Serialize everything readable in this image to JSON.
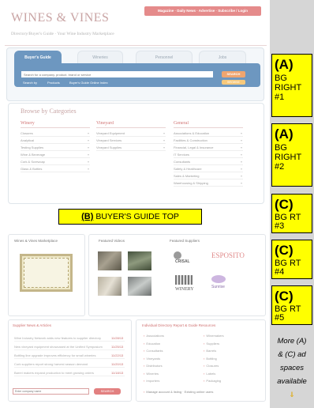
{
  "site": {
    "logo": "WINES & VINES",
    "tagline": "Directory/Buyer's Guide · Your Wine Industry Marketplace",
    "top_link": "Magazine · Daily News · Advertise · Subscribe / Login"
  },
  "search": {
    "tabs": [
      {
        "label": "Buyer's Guide",
        "active": true
      },
      {
        "label": "Wineries",
        "active": false
      },
      {
        "label": "Personnel",
        "active": false
      },
      {
        "label": "Jobs",
        "active": false
      }
    ],
    "placeholder": "Search for a company, product, brand or service",
    "button": "SEARCH",
    "browse": "BROWSE",
    "sublinks": [
      "Search by",
      "Products",
      "Buyer's Guide Online Index"
    ]
  },
  "categories": {
    "title": "Browse by Categories",
    "columns": [
      {
        "heading": "Winery",
        "items": [
          "Closures",
          "Analytical",
          "Testing Supplies",
          "Wine & Beverage",
          "Cork & Screwcap",
          "Glass & Bottles"
        ]
      },
      {
        "heading": "Vineyard",
        "items": [
          "Vineyard Equipment",
          "Vineyard Services",
          "Vineyard Supplies"
        ]
      },
      {
        "heading": "General",
        "items": [
          "Associations & Education",
          "Facilities & Construction",
          "Financial, Legal & Insurance",
          "IT Services",
          "Consultants",
          "Safety & Healthcare",
          "Sales & Marketing",
          "Warehousing & Shipping"
        ]
      }
    ]
  },
  "ad_labels": {
    "buyers_guide_top": {
      "letter": "(B)",
      "text": "BUYER'S GUIDE TOP"
    },
    "side_ads": [
      {
        "letter": "(A)",
        "lines": [
          "BG",
          "RIGHT",
          "#1"
        ]
      },
      {
        "letter": "(A)",
        "lines": [
          "BG",
          "RIGHT",
          "#2"
        ]
      },
      {
        "letter": "(C)",
        "lines": [
          "BG RT",
          "#3"
        ]
      },
      {
        "letter": "(C)",
        "lines": [
          "BG RT",
          "#4"
        ]
      },
      {
        "letter": "(C)",
        "lines": [
          "BG RT",
          "#5"
        ]
      }
    ],
    "more": [
      "More (A)",
      "& (C) ad",
      "spaces",
      "available"
    ],
    "more_arrow": "⇓"
  },
  "panels": {
    "marketplace_title": "Wines & Vines Marketplace",
    "videos_title": "Featured Videos",
    "suppliers_title": "Featured Suppliers",
    "suppliers": [
      "CRISAL",
      "ESPOSITO",
      "WINERY",
      "Sunrise"
    ],
    "news_title": "Supplier News & Articles",
    "news": [
      {
        "text": "Wine Industry Network adds new features to supplier directory",
        "date": "11/28/13"
      },
      {
        "text": "New vineyard equipment showcased at the Unified Symposium",
        "date": "11/25/13"
      },
      {
        "text": "Bottling line upgrade improves efficiency for small wineries",
        "date": "11/22/13"
      },
      {
        "text": "Cork suppliers report strong harvest season demand",
        "date": "11/20/13"
      },
      {
        "text": "Barrel makers expand production to meet growing orders",
        "date": "11/18/13"
      }
    ],
    "news_placeholder": "Enter company name",
    "news_button": "SEARCH",
    "resources_title": "Individual Directory Report & Guide Resources",
    "resources_left": [
      "Associations",
      "Education",
      "Consultants",
      "Vineyards",
      "Distributors",
      "Wineries",
      "Importers"
    ],
    "resources_right": [
      "Winemakers",
      "Suppliers",
      "Barrels",
      "Bottling",
      "Closures",
      "Labels",
      "Packaging"
    ],
    "resources_footer": "Manage account & listing · Existing online users"
  }
}
